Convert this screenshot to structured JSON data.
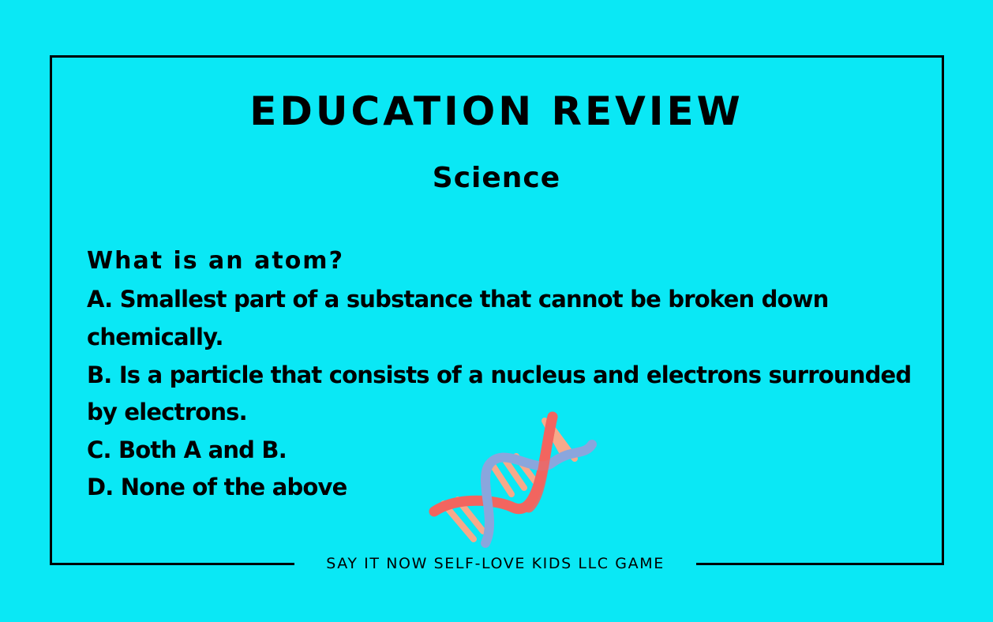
{
  "title": "EDUCATION REVIEW",
  "subject": "Science",
  "question": "What is an atom?",
  "options": [
    {
      "line1": "A. Smallest part of a substance that cannot be broken down",
      "line2": "chemically."
    },
    {
      "line1": "B.  Is a particle that consists of a nucleus and electrons surrounded",
      "line2": "by electrons."
    },
    {
      "line1": "C.  Both A and B."
    },
    {
      "line1": "D.  None of the above"
    }
  ],
  "footer": "SAY IT NOW SELF-LOVE KIDS LLC GAME",
  "colors": {
    "background": "#0ae8f5",
    "dna_red": "#f2655f",
    "dna_blue": "#8aa6dd",
    "dna_base": "#f7a98a"
  },
  "icon": "dna-helix-icon"
}
